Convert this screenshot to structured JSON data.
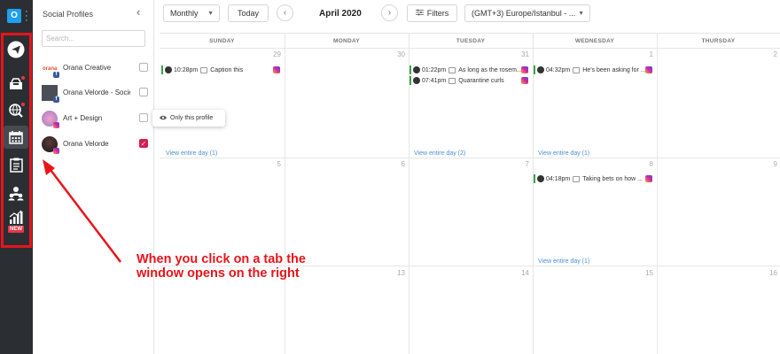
{
  "app": {
    "logo_letter": "O"
  },
  "rail": {
    "items": [
      {
        "name": "publish",
        "icon": "paper-plane-icon"
      },
      {
        "name": "inbox",
        "icon": "inbox-icon"
      },
      {
        "name": "listening",
        "icon": "globe-search-icon"
      },
      {
        "name": "calendar",
        "icon": "calendar-icon",
        "active": true
      },
      {
        "name": "planner",
        "icon": "clipboard-icon"
      },
      {
        "name": "team",
        "icon": "team-icon"
      },
      {
        "name": "analytics",
        "icon": "bar-chart-icon",
        "badge": "NEW"
      }
    ]
  },
  "profiles": {
    "title": "Social Profiles",
    "search_placeholder": "Search...",
    "items": [
      {
        "name": "Orana Creative",
        "network": "facebook",
        "checked": false
      },
      {
        "name": "Orana Velorde - Societ...",
        "network": "facebook",
        "checked": false
      },
      {
        "name": "Art + Design",
        "network": "instagram",
        "checked": false
      },
      {
        "name": "Orana Velorde",
        "network": "instagram",
        "checked": true
      }
    ],
    "tooltip": "Only this profile"
  },
  "toolbar": {
    "view_select": "Monthly",
    "today_label": "Today",
    "month_label": "April 2020",
    "filters_label": "Filters",
    "timezone": "(GMT+3) Europe/Istanbul - ..."
  },
  "calendar": {
    "weekdays": [
      "SUNDAY",
      "MONDAY",
      "TUESDAY",
      "WEDNESDAY",
      "THURSDAY"
    ],
    "weeks": [
      [
        "29",
        "30",
        "31",
        "1",
        "2"
      ],
      [
        "5",
        "6",
        "7",
        "8",
        "9"
      ],
      [
        "12",
        "13",
        "14",
        "15",
        "16"
      ]
    ],
    "posts": [
      {
        "time": "10:28pm",
        "caption": "Caption this"
      },
      {
        "time": "01:22pm",
        "caption": "As long as the rosem..."
      },
      {
        "time": "07:41pm",
        "caption": "Quarantine curls"
      },
      {
        "time": "04:32pm",
        "caption": "He's been asking for ..."
      },
      {
        "time": "04:18pm",
        "caption": "Taking bets on how ..."
      }
    ],
    "view_all": [
      "View entire day (1)",
      "View entire day (2)",
      "View entire day (1)",
      "View entire day (1)"
    ]
  },
  "annotation": {
    "line1": "When you click on a tab the",
    "line2": "window opens on the right",
    "color": "#e8141b"
  }
}
